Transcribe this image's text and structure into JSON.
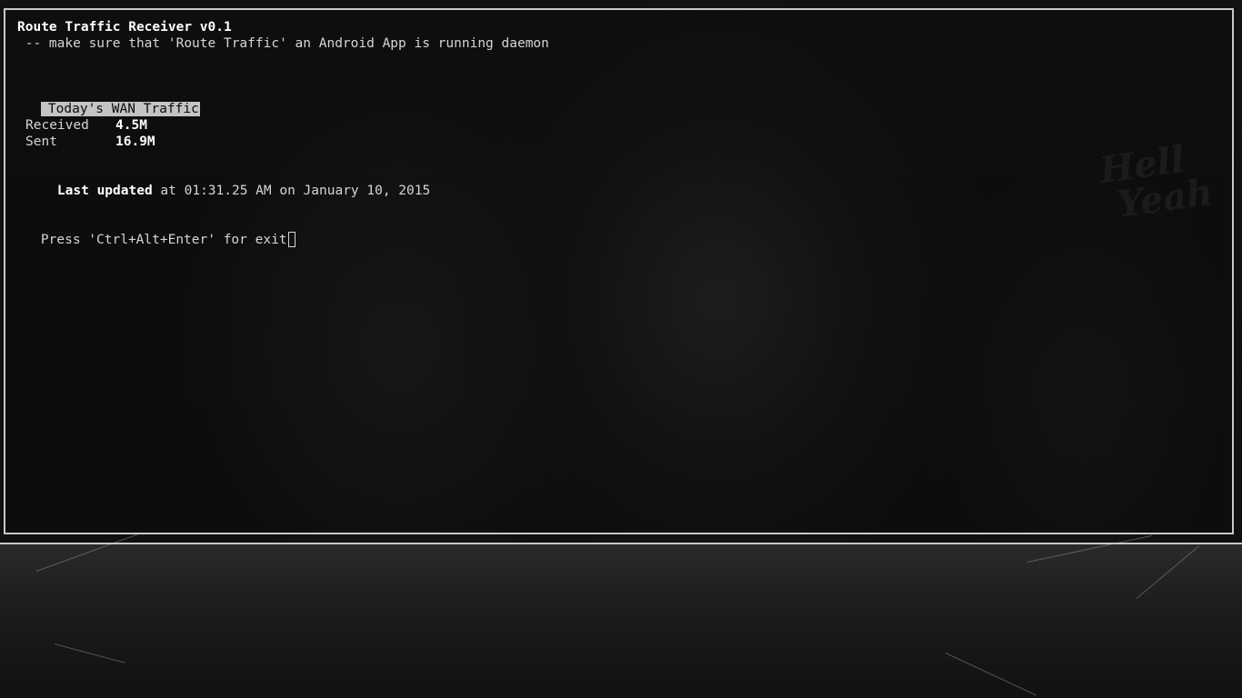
{
  "app": {
    "title": "Route Traffic Receiver v0.1",
    "subtitle": " -- make sure that 'Route Traffic' an Android App is running daemon"
  },
  "wan_section": {
    "heading": "Today's WAN Traffic",
    "received_label": "Received",
    "received_value": "4.5M",
    "sent_label": "Sent",
    "sent_value": "16.9M",
    "last_updated_label": "Last updated",
    "last_updated_value": " at 01:31.25 AM on January 10, 2015"
  },
  "prompt": {
    "text": "Press 'Ctrl+Alt+Enter' for exit"
  },
  "colors": {
    "terminal_border": "#c8c8c8",
    "text": "#d6d6d6",
    "highlight_bg": "#c4c4c4"
  }
}
